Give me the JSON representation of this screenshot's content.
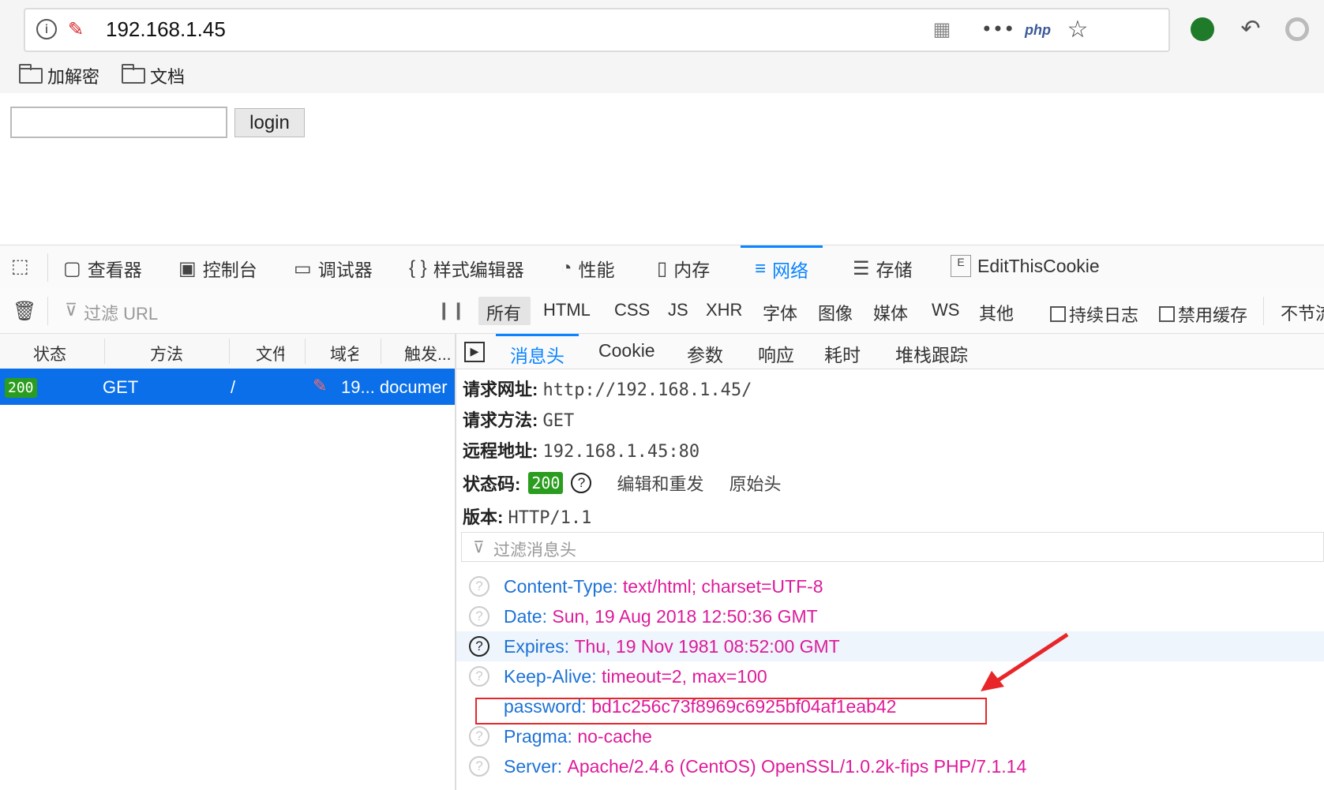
{
  "browser": {
    "url": "192.168.1.45",
    "bookmarks": [
      "加解密",
      "文档"
    ],
    "php_label": "php"
  },
  "page": {
    "login_button": "login",
    "login_value": ""
  },
  "devtools": {
    "tabs": [
      "查看器",
      "控制台",
      "调试器",
      "样式编辑器",
      "性能",
      "内存",
      "网络",
      "存储",
      "EditThisCookie"
    ],
    "active_tab": "网络",
    "filter_placeholder": "过滤 URL",
    "type_filters": [
      "所有",
      "HTML",
      "CSS",
      "JS",
      "XHR",
      "字体",
      "图像",
      "媒体",
      "WS",
      "其他"
    ],
    "checkboxes": [
      "持续日志",
      "禁用缓存"
    ],
    "throttle": "不节流",
    "columns": [
      "状态",
      "方法",
      "文件",
      "域名",
      "触发..."
    ],
    "request": {
      "status": "200",
      "method": "GET",
      "file": "/",
      "cause": "19... documer"
    },
    "detail_tabs": [
      "消息头",
      "Cookie",
      "参数",
      "响应",
      "耗时",
      "堆栈跟踪"
    ],
    "summary": {
      "url_label": "请求网址:",
      "url": "http://192.168.1.45/",
      "method_label": "请求方法:",
      "method": "GET",
      "remote_label": "远程地址:",
      "remote": "192.168.1.45:80",
      "status_label": "状态码:",
      "status": "200",
      "edit_resend": "编辑和重发",
      "raw_headers": "原始头",
      "version_label": "版本:",
      "version": "HTTP/1.1"
    },
    "header_filter_placeholder": "过滤消息头",
    "headers": [
      {
        "name": "Content-Type:",
        "value": "text/html; charset=UTF-8"
      },
      {
        "name": "Date:",
        "value": "Sun, 19 Aug 2018 12:50:36 GMT"
      },
      {
        "name": "Expires:",
        "value": "Thu, 19 Nov 1981 08:52:00 GMT"
      },
      {
        "name": "Keep-Alive:",
        "value": "timeout=2, max=100"
      },
      {
        "name": "password:",
        "value": "bd1c256c73f8969c6925bf04af1eab42"
      },
      {
        "name": "Pragma:",
        "value": "no-cache"
      },
      {
        "name": "Server:",
        "value": "Apache/2.4.6 (CentOS) OpenSSL/1.0.2k-fips PHP/7.1.14"
      }
    ]
  },
  "colors": {
    "selected_row": "#0a6fe8",
    "header_name": "#1c72d6",
    "header_value": "#dd1b9a",
    "annotation": "#e8262a",
    "status_ok": "#2a9d1f"
  }
}
